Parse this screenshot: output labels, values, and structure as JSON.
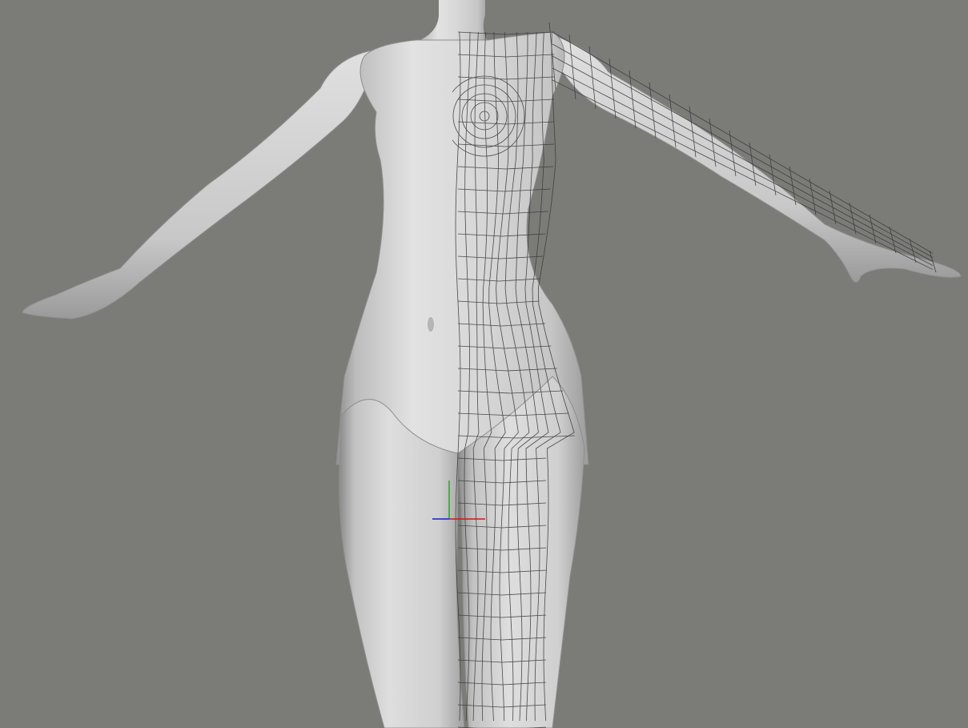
{
  "viewport": {
    "background_color": "#7b7b78",
    "shading": "smooth",
    "wireframe_overlay": "right-half",
    "model": "mannequin-tpose-torso"
  },
  "colors": {
    "mesh_light": "#dcdcdc",
    "mesh_shadow": "#9a9a9a",
    "wire": "#3a3a3a",
    "axis_x": "#d01818",
    "axis_y": "#1ab01a",
    "axis_z": "#1a1ad0"
  },
  "icons": {
    "gizmo": "xyz-axis-gizmo"
  }
}
